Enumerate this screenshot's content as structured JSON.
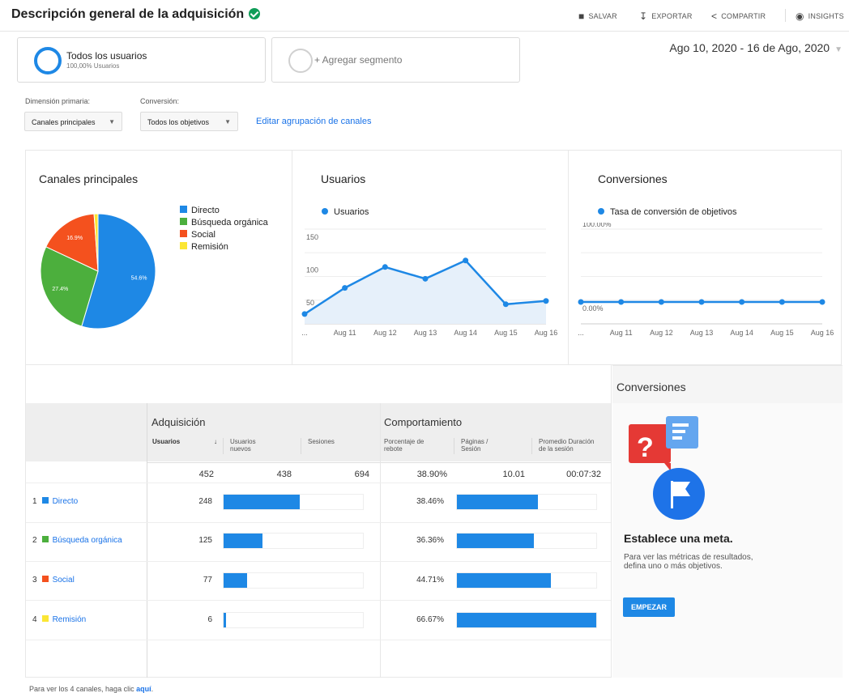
{
  "header": {
    "title": "Descripción general de la adquisición",
    "save_label": "SALVAR",
    "export_label": "EXPORTAR",
    "share_label": "COMPARTIR",
    "insights_label": "INSIGHTS"
  },
  "segments": {
    "all_users_title": "Todos los usuarios",
    "all_users_sub": "100,00% Usuarios",
    "add_segment": "+ Agregar segmento"
  },
  "date_range": "Ago 10, 2020 - 16 de Ago, 2020",
  "dimension": {
    "primary_label": "Dimensión primaria:",
    "primary_value": "Canales principales",
    "conversion_label": "Conversión:",
    "conversion_value": "Todos los objetivos",
    "edit_link": "Editar agrupación de canales"
  },
  "colors": {
    "accent": "#1e88e5",
    "directo": "#1e88e5",
    "organica": "#4caf3d",
    "social": "#f4511e",
    "remision": "#fbe634"
  },
  "chart_data": [
    {
      "type": "pie",
      "title": "Canales principales",
      "categories": [
        "Directo",
        "Búsqueda orgánica",
        "Social",
        "Remisión"
      ],
      "values": [
        54.6,
        27.4,
        16.9,
        1.1
      ],
      "slice_labels": [
        "54.6%",
        "27.4%",
        "16.9%",
        ""
      ],
      "legend": "right"
    },
    {
      "type": "area",
      "title": "Usuarios",
      "series": [
        {
          "name": "Usuarios",
          "values": [
            40,
            80,
            112,
            94,
            122,
            55,
            60
          ]
        }
      ],
      "x_labels": [
        "...",
        "Aug 11",
        "Aug 12",
        "Aug 13",
        "Aug 14",
        "Aug 15",
        "Aug 16"
      ],
      "y_ticks": [
        50,
        100,
        150
      ],
      "ylim": [
        25,
        170
      ],
      "grid": true
    },
    {
      "type": "line",
      "title": "Conversiones",
      "series": [
        {
          "name": "Tasa de conversión de objetivos",
          "values": [
            0,
            0,
            0,
            0,
            0,
            0,
            0
          ]
        }
      ],
      "x_labels": [
        "...",
        "Aug 11",
        "Aug 12",
        "Aug 13",
        "Aug 14",
        "Aug 15",
        "Aug 16"
      ],
      "y_tick_labels": [
        "100.00%",
        "0.00%"
      ],
      "ylim": [
        -30,
        100
      ],
      "grid": true
    }
  ],
  "table": {
    "group_acquisition": "Adquisición",
    "group_behavior": "Comportamiento",
    "col_users": "Usuarios",
    "col_new_users": "Usuarios nuevos",
    "col_sessions": "Sesiones",
    "col_bounce": "Porcentaje de rebote",
    "col_pages": "Páginas / Sesión",
    "col_duration": "Promedio Duración de la sesión",
    "sort_arrow": "↓",
    "totals": {
      "users": "452",
      "new_users": "438",
      "sessions": "694",
      "bounce": "38.90%",
      "pages": "10.01",
      "duration": "00:07:32"
    },
    "rows": [
      {
        "num": "1",
        "name": "Directo",
        "users": "248",
        "users_share": 0.5487,
        "bounce": "38.46%",
        "bounce_bar": 0.583
      },
      {
        "num": "2",
        "name": "Búsqueda orgánica",
        "users": "125",
        "users_share": 0.2765,
        "bounce": "36.36%",
        "bounce_bar": 0.551
      },
      {
        "num": "3",
        "name": "Social",
        "users": "77",
        "users_share": 0.1704,
        "bounce": "44.71%",
        "bounce_bar": 0.677
      },
      {
        "num": "4",
        "name": "Remisión",
        "users": "6",
        "users_share": 0.0133,
        "bounce": "66.67%",
        "bounce_bar": 1.0
      }
    ]
  },
  "footer": {
    "text": "Para ver los 4 canales, haga clic",
    "link": "aquí",
    "dot": "."
  },
  "side": {
    "title": "Conversiones",
    "goal_title": "Establece una meta.",
    "goal_text": "Para ver las métricas de resultados, defina uno o más objetivos.",
    "button": "EMPEZAR"
  }
}
